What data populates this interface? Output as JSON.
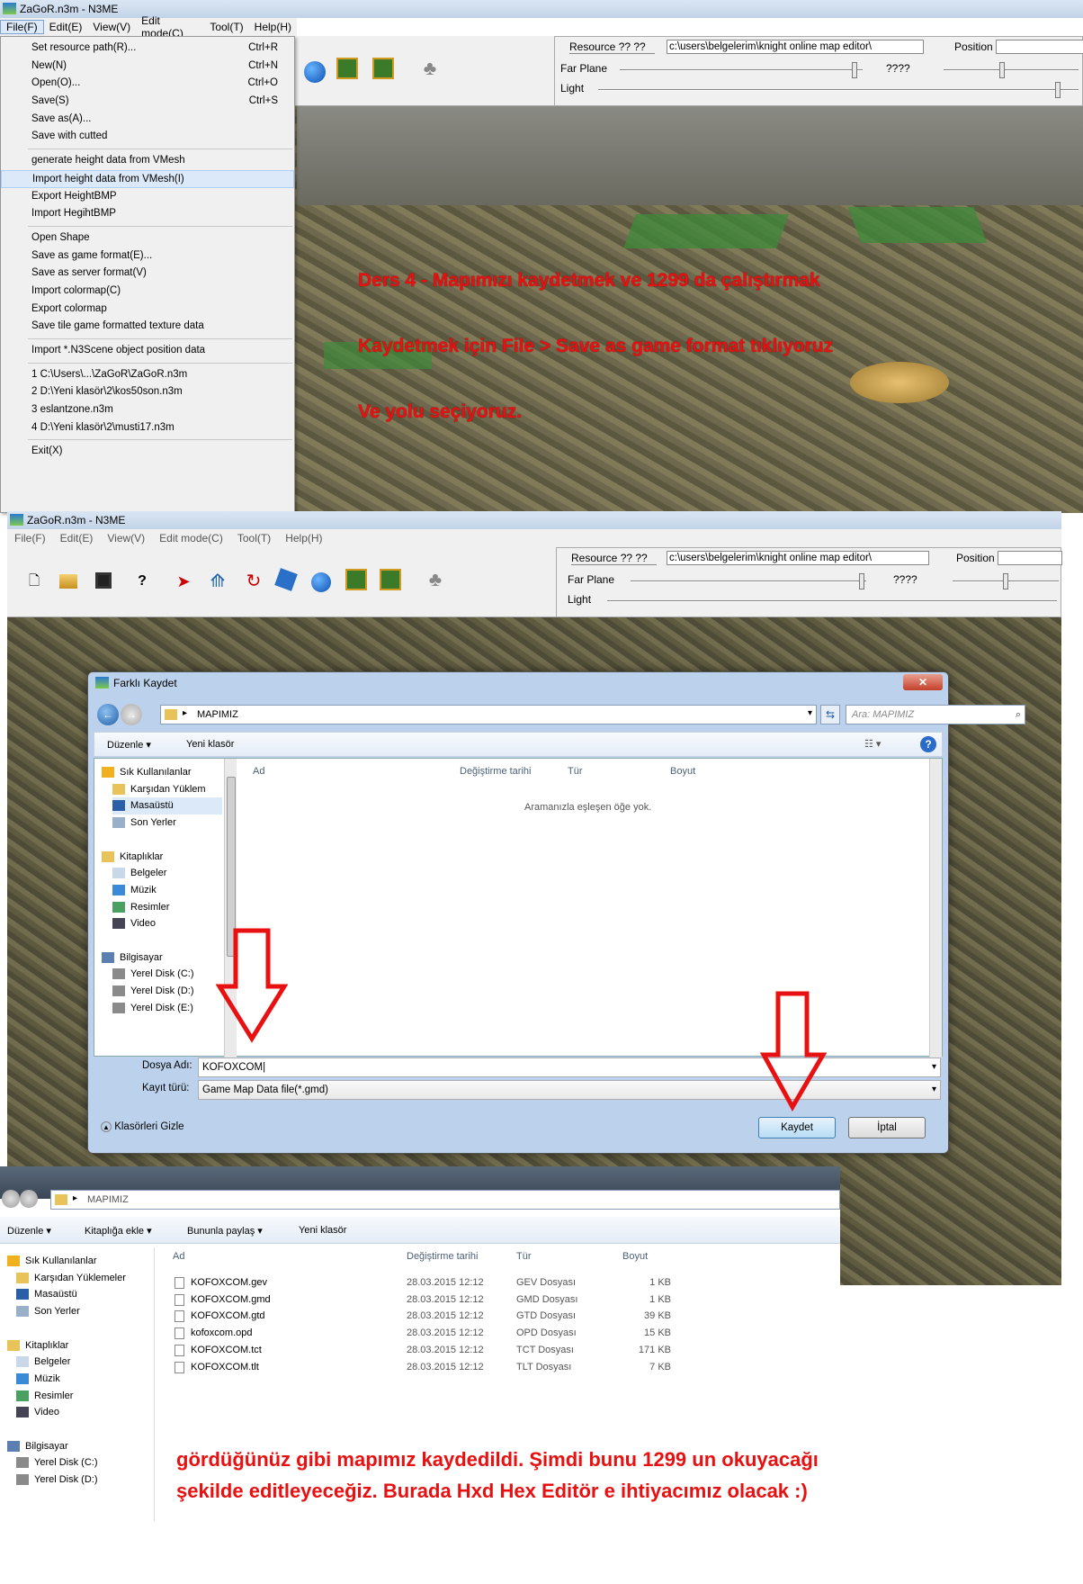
{
  "win1": {
    "title": "ZaGoR.n3m - N3ME",
    "menus": [
      "File(F)",
      "Edit(E)",
      "View(V)",
      "Edit mode(C)",
      "Tool(T)",
      "Help(H)"
    ],
    "file_menu": [
      {
        "label": "Set resource path(R)...",
        "shortcut": "Ctrl+R"
      },
      {
        "label": "New(N)",
        "shortcut": "Ctrl+N"
      },
      {
        "label": "Open(O)...",
        "shortcut": "Ctrl+O"
      },
      {
        "label": "Save(S)",
        "shortcut": "Ctrl+S"
      },
      {
        "label": "Save as(A)...",
        "shortcut": ""
      },
      {
        "label": "Save with cutted",
        "shortcut": ""
      },
      {
        "label": "generate height data from VMesh",
        "shortcut": ""
      },
      {
        "label": "Import height data from VMesh(I)",
        "shortcut": ""
      },
      {
        "label": "Export HeightBMP",
        "shortcut": ""
      },
      {
        "label": "Import HegihtBMP",
        "shortcut": ""
      },
      {
        "label": "Open Shape",
        "shortcut": ""
      },
      {
        "label": "Save as game format(E)...",
        "shortcut": ""
      },
      {
        "label": "Save as server format(V)",
        "shortcut": ""
      },
      {
        "label": "Import colormap(C)",
        "shortcut": ""
      },
      {
        "label": "Export colormap",
        "shortcut": ""
      },
      {
        "label": "Save tile game formatted texture data",
        "shortcut": ""
      },
      {
        "label": "Import *.N3Scene object position data",
        "shortcut": ""
      },
      {
        "label": "1 C:\\Users\\...\\ZaGoR\\ZaGoR.n3m",
        "shortcut": ""
      },
      {
        "label": "2 D:\\Yeni klasör\\2\\kos50son.n3m",
        "shortcut": ""
      },
      {
        "label": "3 eslantzone.n3m",
        "shortcut": ""
      },
      {
        "label": "4 D:\\Yeni klasör\\2\\musti17.n3m",
        "shortcut": ""
      },
      {
        "label": "Exit(X)",
        "shortcut": ""
      }
    ],
    "panel": {
      "resource_label": "Resource ?? ??",
      "resource_path": "c:\\users\\belgelerim\\knight online map editor\\",
      "position_label": "Position",
      "far_plane": "Far Plane",
      "unknown": "????",
      "light": "Light"
    }
  },
  "annotations": {
    "line1": "Ders 4 - Mapımızı kaydetmek  ve 1299 da çalıştırmak",
    "line2": "Kaydetmek için File > Save as game format tıklıyoruz",
    "line3": "Ve yolu seçiyoruz.",
    "bottom1": "gördüğünüz gibi mapımız kaydedildi. Şimdi bunu 1299 un okuyacağı",
    "bottom2": "şekilde editleyeceğiz. Burada Hxd Hex Editör e ihtiyacımız olacak :)"
  },
  "win2": {
    "title": "ZaGoR.n3m - N3ME",
    "menus": [
      "File(F)",
      "Edit(E)",
      "View(V)",
      "Edit mode(C)",
      "Tool(T)",
      "Help(H)"
    ],
    "panel": {
      "resource_label": "Resource ?? ??",
      "resource_path": "c:\\users\\belgelerim\\knight online map editor\\",
      "position_label": "Position",
      "far_plane": "Far Plane",
      "unknown": "????",
      "light": "Light"
    }
  },
  "dialog": {
    "title": "Farklı Kaydet",
    "folder": "MAPIMIZ",
    "search_placeholder": "Ara: MAPIMIZ",
    "organize": "Düzenle",
    "new_folder": "Yeni klasör",
    "columns": [
      "Ad",
      "Değiştirme tarihi",
      "Tür",
      "Boyut"
    ],
    "empty_msg": "Aramanızla eşleşen öğe yok.",
    "tree": [
      {
        "label": "Sık Kullanılanlar",
        "level": 0,
        "icon": "star-icon"
      },
      {
        "label": "Karşıdan Yüklem",
        "level": 1,
        "icon": "download-folder-icon"
      },
      {
        "label": "Masaüstü",
        "level": 1,
        "icon": "desktop-icon",
        "selected": true
      },
      {
        "label": "Son Yerler",
        "level": 1,
        "icon": "recent-icon"
      },
      {
        "label": "",
        "level": -1
      },
      {
        "label": "Kitaplıklar",
        "level": 0,
        "icon": "library-icon"
      },
      {
        "label": "Belgeler",
        "level": 1,
        "icon": "documents-icon"
      },
      {
        "label": "Müzik",
        "level": 1,
        "icon": "music-icon"
      },
      {
        "label": "Resimler",
        "level": 1,
        "icon": "pictures-icon"
      },
      {
        "label": "Video",
        "level": 1,
        "icon": "video-icon"
      },
      {
        "label": "",
        "level": -1
      },
      {
        "label": "Bilgisayar",
        "level": 0,
        "icon": "computer-icon"
      },
      {
        "label": "Yerel Disk (C:)",
        "level": 1,
        "icon": "drive-icon"
      },
      {
        "label": "Yerel Disk (D:)",
        "level": 1,
        "icon": "drive-icon"
      },
      {
        "label": "Yerel Disk (E:)",
        "level": 1,
        "icon": "drive-icon"
      }
    ],
    "filename_label": "Dosya Adı:",
    "filename_value": "KOFOXCOM",
    "type_label": "Kayıt türü:",
    "type_value": "Game Map Data file(*.gmd)",
    "hide_folders": "Klasörleri Gizle",
    "save": "Kaydet",
    "cancel": "İptal"
  },
  "explorer": {
    "folder": "MAPIMIZ",
    "toolbar": [
      "Düzenle",
      "Kitaplığa ekle",
      "Bununla paylaş",
      "Yeni klasör"
    ],
    "columns": [
      "Ad",
      "Değiştirme tarihi",
      "Tür",
      "Boyut"
    ],
    "tree": [
      {
        "label": "Sık Kullanılanlar",
        "level": 0,
        "icon": "star-icon"
      },
      {
        "label": "Karşıdan Yüklemeler",
        "level": 1,
        "icon": "download-folder-icon"
      },
      {
        "label": "Masaüstü",
        "level": 1,
        "icon": "desktop-icon"
      },
      {
        "label": "Son Yerler",
        "level": 1,
        "icon": "recent-icon"
      },
      {
        "label": "",
        "level": -1
      },
      {
        "label": "Kitaplıklar",
        "level": 0,
        "icon": "library-icon"
      },
      {
        "label": "Belgeler",
        "level": 1,
        "icon": "documents-icon"
      },
      {
        "label": "Müzik",
        "level": 1,
        "icon": "music-icon"
      },
      {
        "label": "Resimler",
        "level": 1,
        "icon": "pictures-icon"
      },
      {
        "label": "Video",
        "level": 1,
        "icon": "video-icon"
      },
      {
        "label": "",
        "level": -1
      },
      {
        "label": "Bilgisayar",
        "level": 0,
        "icon": "computer-icon"
      },
      {
        "label": "Yerel Disk (C:)",
        "level": 1,
        "icon": "drive-icon"
      },
      {
        "label": "Yerel Disk (D:)",
        "level": 1,
        "icon": "drive-icon"
      }
    ],
    "files": [
      {
        "name": "KOFOXCOM.gev",
        "date": "28.03.2015 12:12",
        "type": "GEV Dosyası",
        "size": "1 KB"
      },
      {
        "name": "KOFOXCOM.gmd",
        "date": "28.03.2015 12:12",
        "type": "GMD Dosyası",
        "size": "1 KB"
      },
      {
        "name": "KOFOXCOM.gtd",
        "date": "28.03.2015 12:12",
        "type": "GTD Dosyası",
        "size": "39 KB"
      },
      {
        "name": "kofoxcom.opd",
        "date": "28.03.2015 12:12",
        "type": "OPD Dosyası",
        "size": "15 KB"
      },
      {
        "name": "KOFOXCOM.tct",
        "date": "28.03.2015 12:12",
        "type": "TCT Dosyası",
        "size": "171 KB"
      },
      {
        "name": "KOFOXCOM.tlt",
        "date": "28.03.2015 12:12",
        "type": "TLT Dosyası",
        "size": "7 KB"
      }
    ]
  },
  "colors": {
    "accent_red": "#e81010",
    "selection_blue": "#dce9f8",
    "title_blue": "#c2d3e8"
  }
}
